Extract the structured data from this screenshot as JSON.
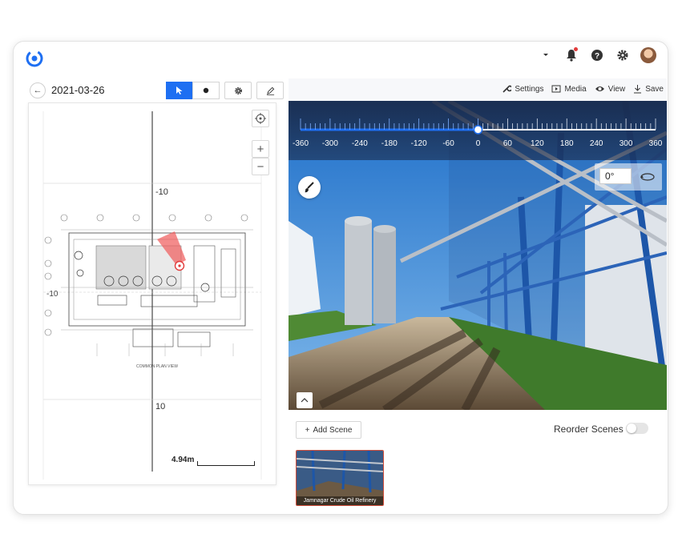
{
  "header": {
    "icons": [
      "app-logo",
      "caret-down-icon",
      "bell-icon",
      "help-icon",
      "gear-icon",
      "avatar"
    ]
  },
  "left_panel": {
    "date": "2021-03-26",
    "toolbar": {
      "tools": [
        "select-cursor-icon",
        "dot-icon",
        "gear-icon",
        "pen-icon"
      ],
      "active": "select-cursor-icon"
    },
    "floorplan": {
      "grid_labels": [
        "-10",
        "-10",
        "10"
      ],
      "caption": "COMMON PLAN VIEW",
      "scale": "4.94m",
      "zoom_in": "+",
      "zoom_out": "−"
    }
  },
  "right_panel": {
    "actions": {
      "settings": "Settings",
      "media": "Media",
      "view": "View",
      "save": "Save"
    },
    "viewer": {
      "ruler_labels": [
        "-360",
        "-300",
        "-240",
        "-180",
        "-120",
        "-60",
        "0",
        "60",
        "120",
        "180",
        "240",
        "300",
        "360"
      ],
      "ruler_value": 0,
      "rotation": "0°"
    },
    "add_scene_label": "Add Scene",
    "reorder_label": "Reorder Scenes",
    "reorder_on": false,
    "scenes": [
      {
        "name": "Jamnagar Crude Oil Refinery"
      }
    ]
  },
  "colors": {
    "accent": "#1e6ff2",
    "heading_marker": "#e23b3b"
  }
}
